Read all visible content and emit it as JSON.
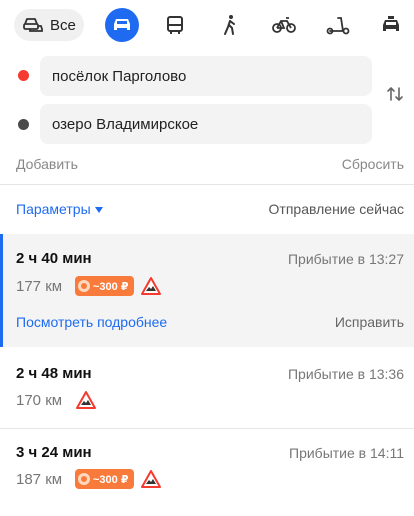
{
  "modes": {
    "all_label": "Все",
    "items": [
      "cars-icon",
      "car-icon",
      "bus-icon",
      "walk-icon",
      "bike-icon",
      "scooter-icon",
      "taxi-icon"
    ],
    "active": "car-icon"
  },
  "route_form": {
    "from_value": "посёлок Парголово",
    "to_value": "озеро Владимирское",
    "add_label": "Добавить",
    "reset_label": "Сбросить"
  },
  "options": {
    "params_label": "Параметры",
    "departure_label": "Отправление сейчас"
  },
  "routes": [
    {
      "duration": "2 ч 40 мин",
      "arrival": "Прибытие в 13:27",
      "distance": "177 км",
      "toll": "~300 ₽",
      "details_label": "Посмотреть подробнее",
      "fix_label": "Исправить",
      "selected": true
    },
    {
      "duration": "2 ч 48 мин",
      "arrival": "Прибытие в 13:36",
      "distance": "170 км"
    },
    {
      "duration": "3 ч 24 мин",
      "arrival": "Прибытие в 14:11",
      "distance": "187 км",
      "toll": "~300 ₽"
    }
  ],
  "colors": {
    "accent": "#1e6bf1",
    "from_dot": "#f53a2f",
    "to_dot": "#4a4a4a",
    "toll_badge": "#f97b3c",
    "warning": "#f53a2f"
  }
}
